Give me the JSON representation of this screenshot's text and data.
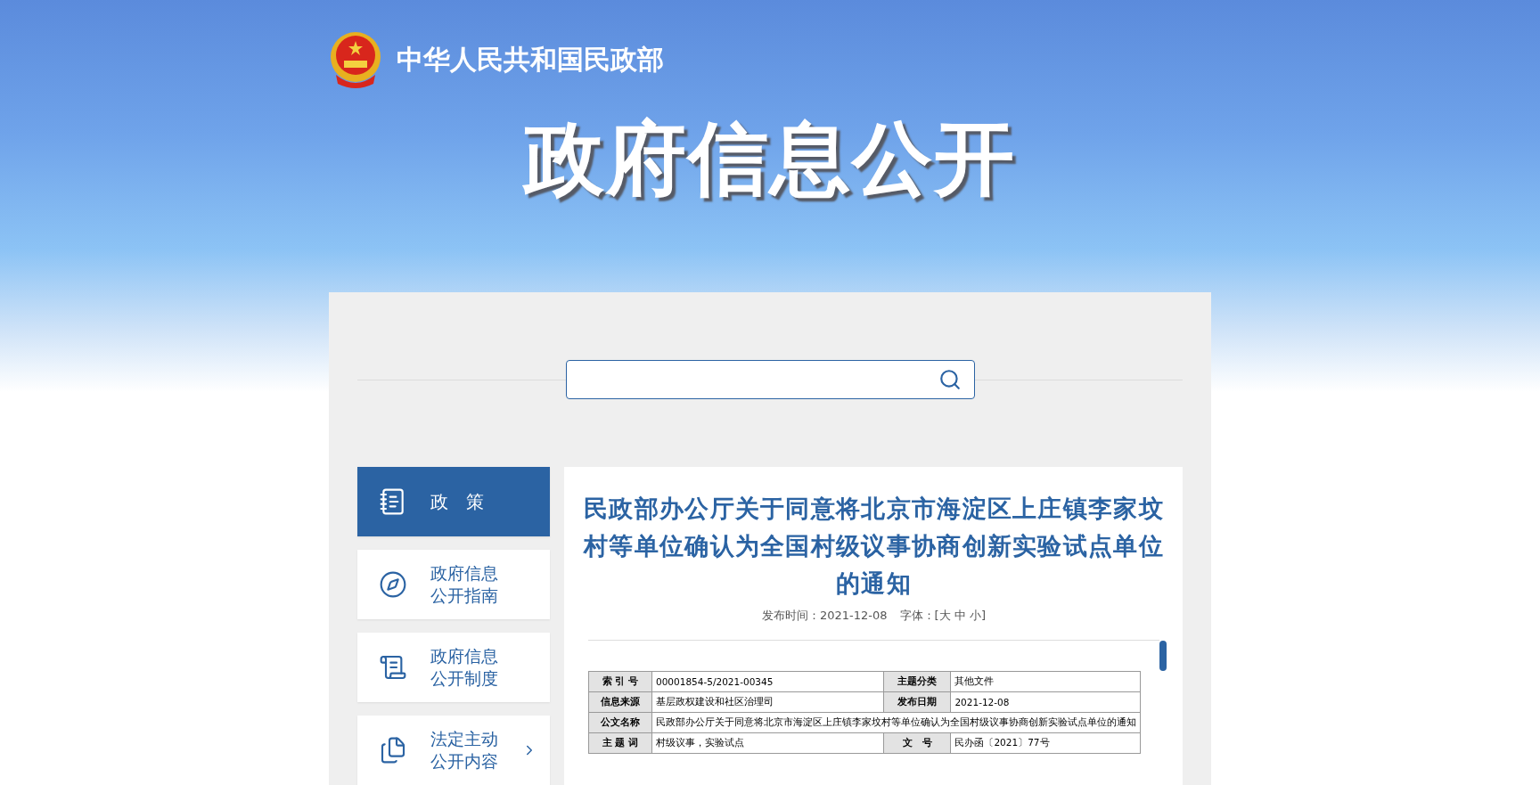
{
  "site": {
    "name": "中华人民共和国民政部",
    "banner_title": "政府信息公开"
  },
  "sidebar": {
    "items": [
      {
        "label": "政　策",
        "kind": "policy",
        "selected": true,
        "expandable": false
      },
      {
        "label": "政府信息公开指南",
        "kind": "guide",
        "selected": false,
        "expandable": false
      },
      {
        "label": "政府信息公开制度",
        "kind": "rules",
        "selected": false,
        "expandable": false
      },
      {
        "label": "法定主动公开内容",
        "kind": "content",
        "selected": false,
        "expandable": true
      }
    ]
  },
  "article": {
    "title": "民政部办公厅关于同意将北京市海淀区上庄镇李家坟村等单位确认为全国村级议事协商创新实验试点单位的通知",
    "published": "发布时间：2021-12-08",
    "font_size": "字体：[大 中 小]",
    "info_table": [
      [
        {
          "kind": "label",
          "text": "索 引 号"
        },
        {
          "kind": "value",
          "text": "00001854-5/2021-00345"
        },
        {
          "kind": "label",
          "text": "主题分类"
        },
        {
          "kind": "value",
          "text": "其他文件"
        }
      ],
      [
        {
          "kind": "label",
          "text": "信息来源"
        },
        {
          "kind": "value",
          "text": "基层政权建设和社区治理司"
        },
        {
          "kind": "label",
          "text": "发布日期"
        },
        {
          "kind": "value",
          "text": "2021-12-08"
        }
      ],
      [
        {
          "kind": "label",
          "text": "公文名称"
        },
        {
          "kind": "value",
          "text": "民政部办公厅关于同意将北京市海淀区上庄镇李家坟村等单位确认为全国村级议事协商创新实验试点单位的通知"
        }
      ],
      [
        {
          "kind": "label",
          "text": "主 题 词"
        },
        {
          "kind": "value",
          "text": "村级议事，实验试点"
        },
        {
          "kind": "label",
          "text": "文　号"
        },
        {
          "kind": "value",
          "text": "民办函〔2021〕77号"
        }
      ]
    ]
  }
}
